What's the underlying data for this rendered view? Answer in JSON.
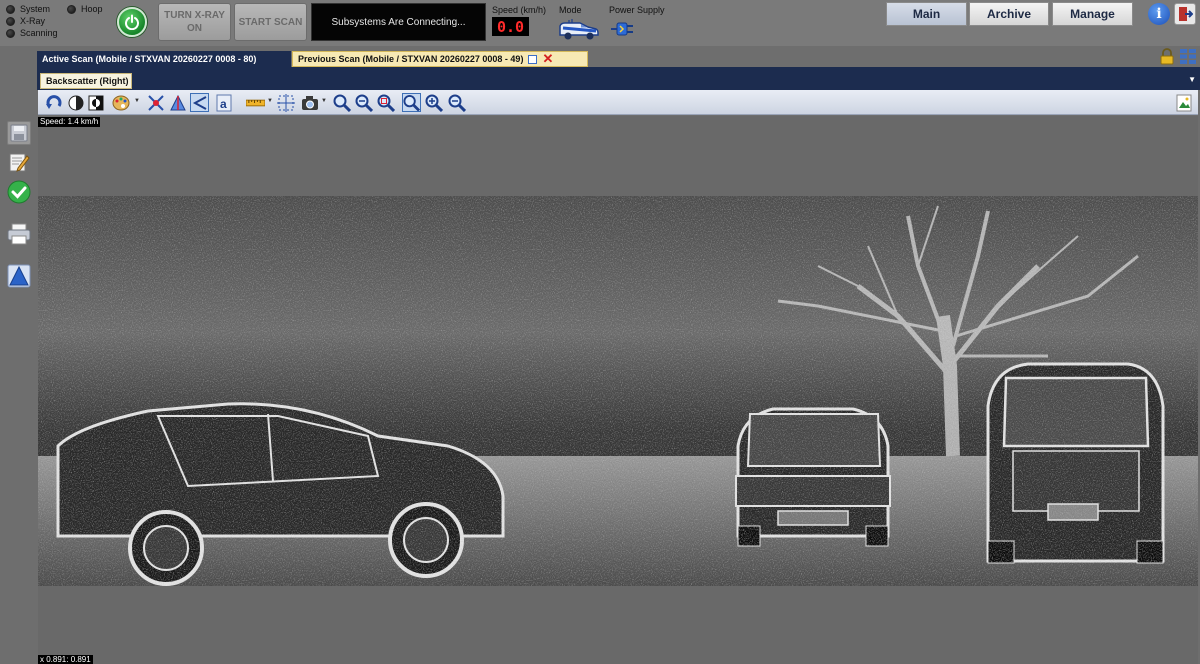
{
  "status_indicators": [
    {
      "label": "System"
    },
    {
      "label": "X-Ray"
    },
    {
      "label": "Scanning"
    },
    {
      "label": "Hoop"
    }
  ],
  "controls": {
    "turn_xray_on": "TURN X-RAY ON",
    "start_scan": "START SCAN",
    "status_message": "Subsystems Are Connecting..."
  },
  "speed": {
    "label": "Speed (km/h)",
    "value": "0.0"
  },
  "mode": {
    "label": "Mode",
    "icon": "van-icon"
  },
  "power_supply": {
    "label": "Power Supply",
    "icon": "plug-icon"
  },
  "nav": {
    "main": "Main",
    "archive": "Archive",
    "manage": "Manage",
    "active": "Main"
  },
  "tabs": [
    {
      "label": "Active Scan (Mobile / STXVAN 20260227 0008 - 80)"
    },
    {
      "label": "Previous Scan (Mobile / STXVAN 20260227 0008 - 49)"
    }
  ],
  "subtab": {
    "label": "Backscatter (Right)"
  },
  "toolbar_icons": [
    "rotate-icon",
    "contrast-icon",
    "invert-icon",
    "palette-icon",
    "edge-filter-icon",
    "sharpen-icon",
    "measure-angle-icon",
    "annotate-text-icon",
    "ruler-icon",
    "crosshair-icon",
    "camera-icon",
    "zoom-in-icon",
    "zoom-out-icon",
    "zoom-region-icon",
    "zoom-fit-icon",
    "zoom-plus-icon",
    "zoom-minus-icon"
  ],
  "sidebar_icons": [
    "save-icon",
    "edit-icon",
    "check-icon",
    "print-icon",
    "upload-icon"
  ],
  "image_overlay": {
    "speed_text": "Speed: 1.4 km/h",
    "coords_text": "x 0.891: 0.891"
  },
  "colors": {
    "header_navy": "#1c2c4f",
    "led_off": "#1a1a1a",
    "power_green": "#2fae3f",
    "speed_red": "#ff2a2a",
    "tab_highlight": "#f7e9b4"
  }
}
